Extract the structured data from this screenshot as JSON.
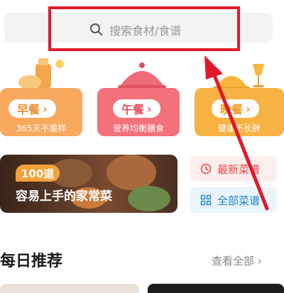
{
  "search": {
    "placeholder": "搜索食材/食谱"
  },
  "meals": [
    {
      "label": "早餐",
      "subtitle": "365天不重样"
    },
    {
      "label": "午餐",
      "subtitle": "营养均衡膳食"
    },
    {
      "label": "晚餐",
      "subtitle": "健康不长胖"
    }
  ],
  "banner": {
    "tag": "100道",
    "title": "容易上手的家常菜"
  },
  "side_buttons": {
    "latest": "最新菜谱",
    "all": "全部菜谱"
  },
  "daily": {
    "title": "每日推荐",
    "view_all": "查看全部"
  },
  "colors": {
    "highlight": "#e0192a",
    "breakfast": "#f8a95e",
    "lunch": "#f2717a",
    "dinner": "#f7b244"
  }
}
